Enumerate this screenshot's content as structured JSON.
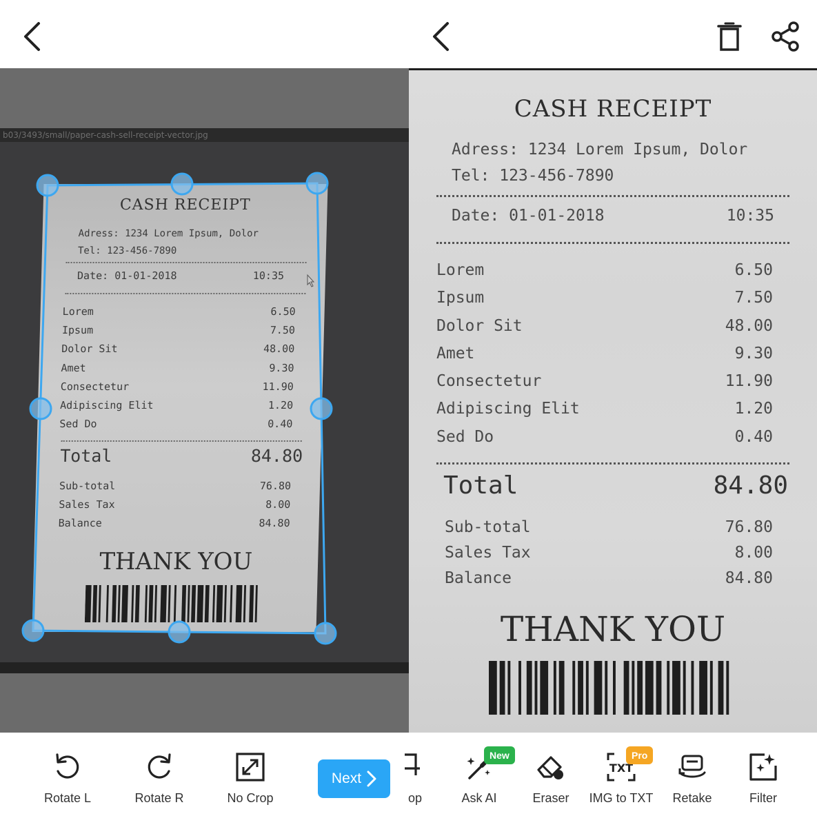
{
  "left": {
    "photo_strip_text": "b03/3493/small/paper-cash-sell-receipt-vector.jpg",
    "receipt": {
      "title": "CASH RECEIPT",
      "address": "Adress: 1234 Lorem Ipsum, Dolor",
      "tel": "Tel: 123-456-7890",
      "date": "Date: 01-01-2018",
      "time": "10:35",
      "items": [
        {
          "name": "Lorem",
          "price": "6.50"
        },
        {
          "name": "Ipsum",
          "price": "7.50"
        },
        {
          "name": "Dolor Sit",
          "price": "48.00"
        },
        {
          "name": "Amet",
          "price": "9.30"
        },
        {
          "name": "Consectetur",
          "price": "11.90"
        },
        {
          "name": "Adipiscing Elit",
          "price": "1.20"
        },
        {
          "name": "Sed Do",
          "price": "0.40"
        }
      ],
      "total_label": "Total",
      "total_value": "84.80",
      "summary": [
        {
          "name": "Sub-total",
          "price": "76.80"
        },
        {
          "name": "Sales Tax",
          "price": "8.00"
        },
        {
          "name": "Balance",
          "price": "84.80"
        }
      ],
      "thanks": "THANK YOU"
    }
  },
  "right": {
    "receipt": {
      "title": "CASH RECEIPT",
      "address": "Adress: 1234 Lorem Ipsum, Dolor",
      "tel": "Tel: 123-456-7890",
      "date": "Date: 01-01-2018",
      "time": "10:35",
      "items": [
        {
          "name": "Lorem",
          "price": "6.50"
        },
        {
          "name": "Ipsum",
          "price": "7.50"
        },
        {
          "name": "Dolor Sit",
          "price": "48.00"
        },
        {
          "name": "Amet",
          "price": "9.30"
        },
        {
          "name": "Consectetur",
          "price": "11.90"
        },
        {
          "name": "Adipiscing Elit",
          "price": "1.20"
        },
        {
          "name": "Sed Do",
          "price": "0.40"
        }
      ],
      "total_label": "Total",
      "total_value": "84.80",
      "summary": [
        {
          "name": "Sub-total",
          "price": "76.80"
        },
        {
          "name": "Sales Tax",
          "price": "8.00"
        },
        {
          "name": "Balance",
          "price": "84.80"
        }
      ],
      "thanks": "THANK YOU"
    }
  },
  "toolbar": {
    "rotate_left": "Rotate L",
    "rotate_right": "Rotate R",
    "no_crop": "No Crop",
    "next": "Next",
    "crop_partial": "op",
    "ask_ai": "Ask AI",
    "ask_ai_badge": "New",
    "eraser": "Eraser",
    "img_to_txt": "IMG to TXT",
    "img_to_txt_badge": "Pro",
    "retake": "Retake",
    "filter": "Filter"
  },
  "colors": {
    "accent": "#2aa6f6",
    "crop_frame": "#3da7f0",
    "badge_new": "#2bb24c",
    "badge_pro": "#f5a623"
  },
  "icons": {
    "back": "chevron-left-icon",
    "delete": "trash-icon",
    "share": "share-icon"
  }
}
